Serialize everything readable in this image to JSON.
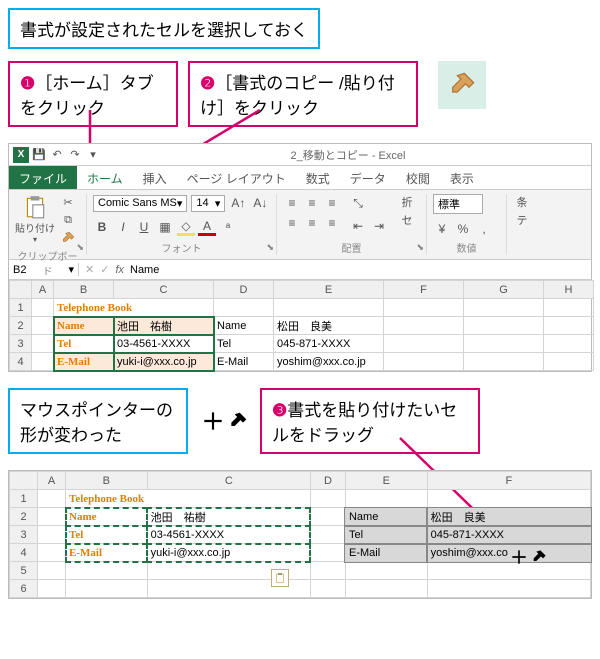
{
  "callouts": {
    "intro": "書式が設定されたセルを選択しておく",
    "step1_num": "❶",
    "step1_text": "［ホーム］タブをクリック",
    "step2_num": "❷",
    "step2_text": "［書式のコピー /貼り付け］をクリック",
    "mid_blue": "マウスポインターの形が変わった",
    "step3_num": "❸",
    "step3_text": "書式を貼り付けたいセルをドラッグ"
  },
  "excel": {
    "window_title": "2_移動とコピー - Excel",
    "tabs": {
      "file": "ファイル",
      "home": "ホーム",
      "insert": "挿入",
      "layout": "ページ レイアウト",
      "formula": "数式",
      "data": "データ",
      "review": "校閲",
      "view": "表示"
    },
    "ribbon": {
      "paste_label": "貼り付け",
      "clipboard_group": "クリップボード",
      "font_name": "Comic Sans MS",
      "font_size": "14",
      "font_group": "フォント",
      "align_group": "配置",
      "wrap": "折",
      "merge": "セ",
      "number_format": "標準",
      "number_group": "数値",
      "cond_fmt": "条",
      "table_fmt": "テ"
    },
    "namebox": "B2",
    "formula_bar": "Name",
    "cols": [
      "",
      "A",
      "B",
      "C",
      "D",
      "E",
      "F",
      "G",
      "H"
    ],
    "titlecell": "Telephone Book",
    "left": {
      "r1": {
        "label": "Name",
        "val": "池田　祐樹"
      },
      "r2": {
        "label": "Tel",
        "val": "03-4561-XXXX"
      },
      "r3": {
        "label": "E-Mail",
        "val": "yuki-i@xxx.co.jp"
      }
    },
    "right": {
      "r1": {
        "label": "Name",
        "val": "松田　良美"
      },
      "r2": {
        "label": "Tel",
        "val": "045-871-XXXX"
      },
      "r3": {
        "label": "E-Mail",
        "val": "yoshim@xxx.co.jp"
      }
    }
  },
  "grid2": {
    "cols": [
      "",
      "A",
      "B",
      "C",
      "D",
      "E",
      "F"
    ],
    "title": "Telephone Book",
    "left": {
      "r1": {
        "label": "Name",
        "val": "池田　祐樹"
      },
      "r2": {
        "label": "Tel",
        "val": "03-4561-XXXX"
      },
      "r3": {
        "label": "E-Mail",
        "val": "yuki-i@xxx.co.jp"
      }
    },
    "right": {
      "r1": {
        "label": "Name",
        "val": "松田　良美"
      },
      "r2": {
        "label": "Tel",
        "val": "045-871-XXXX"
      },
      "r3": {
        "label": "E-Mail",
        "val": "yoshim@xxx.co"
      }
    }
  },
  "icons": {
    "cut": "✂",
    "copy": "⧉",
    "brush": "🖌",
    "fx": "fx",
    "dropdown": "▾",
    "save": "💾",
    "undo": "↶",
    "redo": "↷",
    "excel": "X"
  }
}
